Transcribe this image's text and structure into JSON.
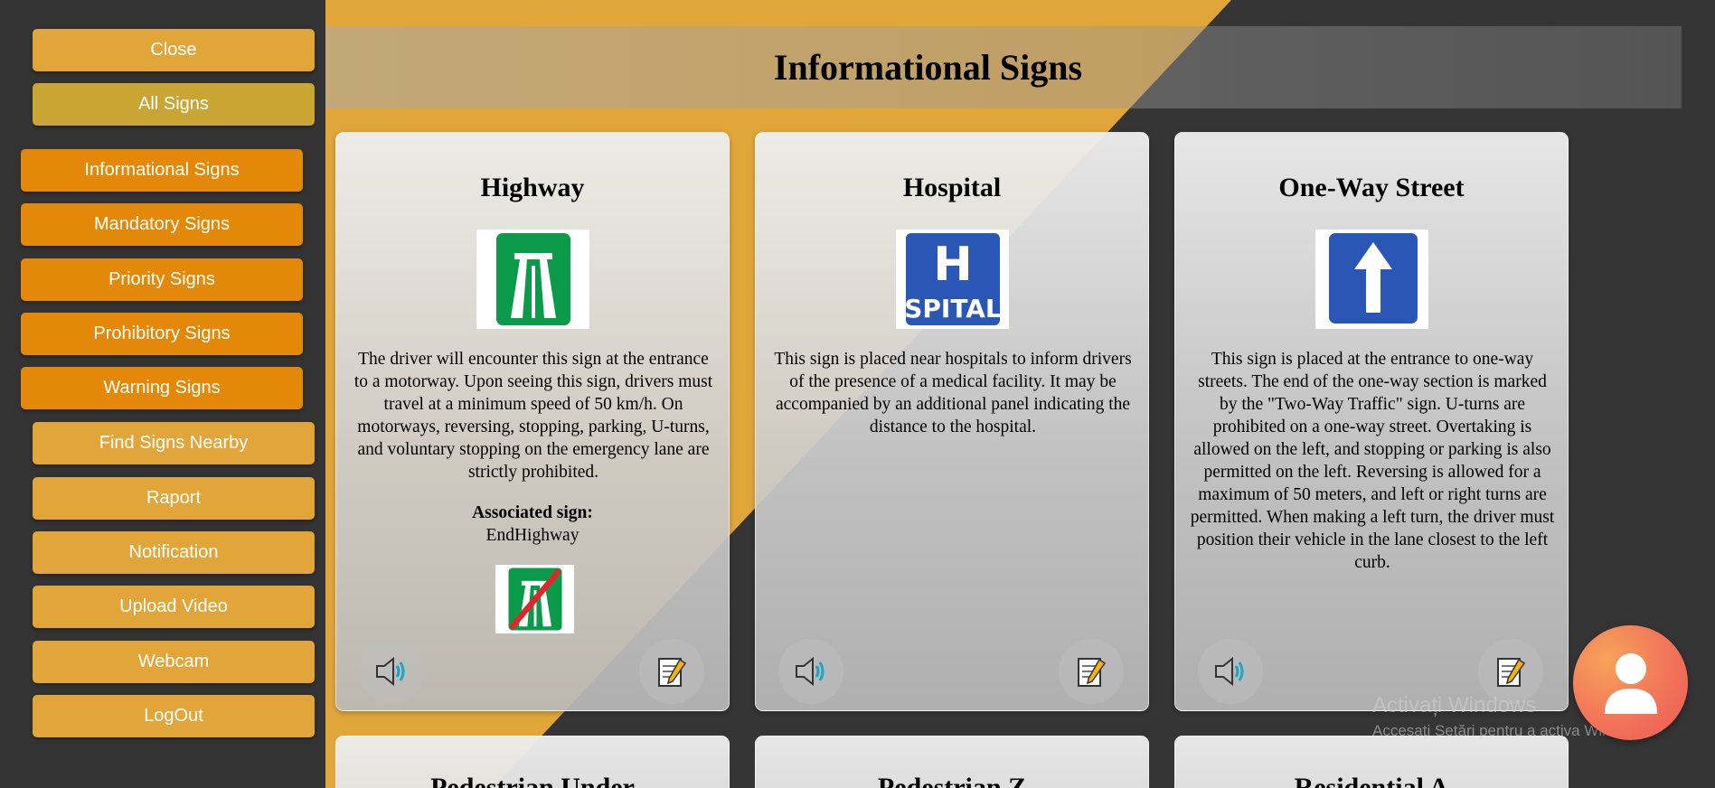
{
  "sidebar": {
    "close": "Close",
    "all_signs": "All Signs",
    "categories": [
      "Informational Signs",
      "Mandatory Signs",
      "Priority Signs",
      "Prohibitory Signs",
      "Warning Signs"
    ],
    "links": [
      "Find Signs Nearby",
      "Raport",
      "Notification",
      "Upload Video",
      "Webcam",
      "LogOut"
    ]
  },
  "page": {
    "title": "Informational Signs"
  },
  "cards": [
    {
      "title": "Highway",
      "sign_icon": "motorway-sign",
      "description": "The driver will encounter this sign at the entrance to a motorway. Upon seeing this sign, drivers must travel at a minimum speed of 50 km/h. On motorways, reversing, stopping, parking, U-turns, and voluntary stopping on the emergency lane are strictly prohibited.",
      "assoc_label": "Associated sign:",
      "assoc_name": "EndHighway",
      "assoc_icon": "end-motorway-sign"
    },
    {
      "title": "Hospital",
      "sign_icon": "hospital-sign",
      "sign_text_top": "H",
      "sign_text_bottom": "SPITAL",
      "description": "This sign is placed near hospitals to inform drivers of the presence of a medical facility. It may be accompanied by an additional panel indicating the distance to the hospital."
    },
    {
      "title": "One-Way Street",
      "sign_icon": "one-way-sign",
      "description": "This sign is placed at the entrance to one-way streets. The end of the one-way section is marked by the \"Two-Way Traffic\" sign. U-turns are prohibited on a one-way street. Overtaking is allowed on the left, and stopping or parking is also permitted on the left. Reversing is allowed for a maximum of 50 meters, and left or right turns are permitted. When making a left turn, the driver must position their vehicle in the lane closest to the left curb."
    }
  ],
  "bottom_cards": [
    "Pedestrian Under",
    "Pedestrian Z",
    "Residential A"
  ],
  "watermark": {
    "line1": "Activați Windows",
    "line2": "Accesați Setări pentru a activa Windows."
  },
  "colors": {
    "sidebar_bg": "#333333",
    "button_main": "#e2a53a",
    "button_category": "#e38808",
    "button_active": "#c9a634",
    "accent_orange": "#e1a63a",
    "chat_button": "#f2745a"
  },
  "icons": {
    "audio": "speaker-icon",
    "notes": "memo-icon",
    "chat": "user-avatar-icon"
  }
}
